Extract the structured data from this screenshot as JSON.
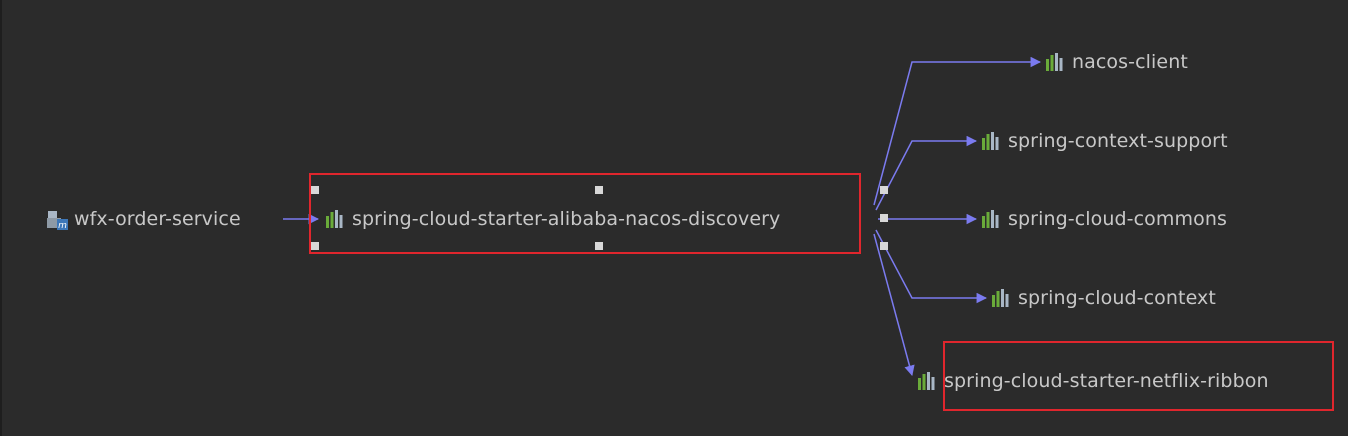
{
  "root": {
    "label": "wfx-order-service",
    "icon": "module-icon"
  },
  "selected": {
    "label": "spring-cloud-starter-alibaba-nacos-discovery",
    "icon": "library-icon"
  },
  "children": [
    {
      "label": "nacos-client",
      "icon": "library-icon"
    },
    {
      "label": "spring-context-support",
      "icon": "library-icon"
    },
    {
      "label": "spring-cloud-commons",
      "icon": "library-icon"
    },
    {
      "label": "spring-cloud-context",
      "icon": "library-icon"
    },
    {
      "label": "spring-cloud-starter-netflix-ribbon",
      "icon": "library-icon"
    }
  ],
  "colors": {
    "background": "#2b2b2b",
    "edge": "#7b7bf0",
    "highlight": "#e0262d",
    "text": "#c8c8c8",
    "icon_green": "#6aab3a",
    "icon_gray": "#a9b7c6"
  }
}
